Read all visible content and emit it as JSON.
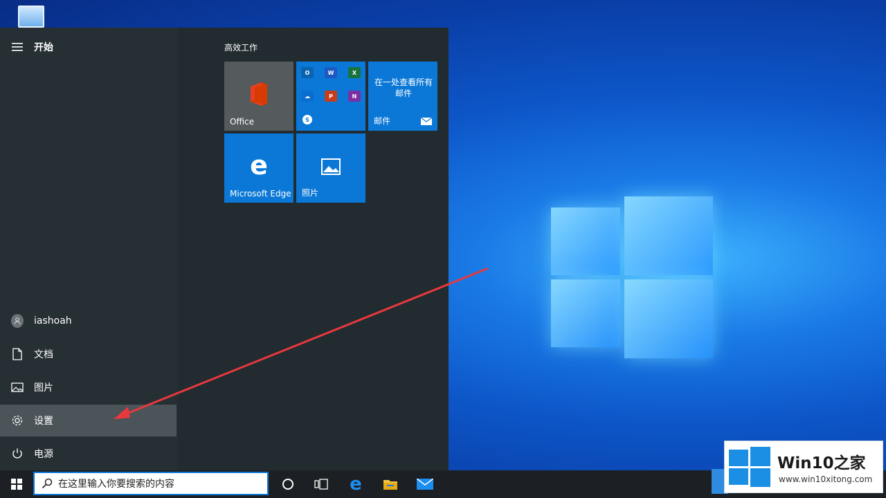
{
  "start_menu": {
    "title": "开始",
    "user_name": "iashoah",
    "documents": "文档",
    "pictures": "图片",
    "settings": "设置",
    "power": "电源",
    "group_title": "高效工作",
    "tiles": {
      "office": "Office",
      "mail_heading": "在一处查看所有邮件",
      "mail": "邮件",
      "edge": "Microsoft Edge",
      "photos": "照片"
    },
    "mini_apps": [
      "O",
      "W",
      "X",
      "",
      "P",
      "N"
    ]
  },
  "taskbar": {
    "search_placeholder": "在这里输入你要搜索的内容"
  },
  "watermark": {
    "title": "Win10之家",
    "url": "www.win10xitong.com"
  },
  "colors": {
    "accent": "#0b78d7",
    "office_red": "#d83b01",
    "arrow": "#e8383d"
  }
}
